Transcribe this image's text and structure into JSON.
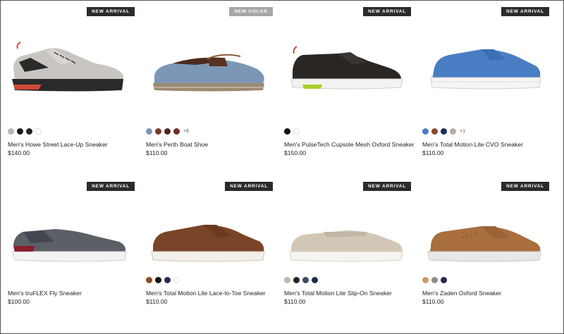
{
  "products": [
    {
      "badge": "NEW ARRIVAL",
      "badge_style": "dark",
      "name": "Men's Howe Street Lace-Up Sneaker",
      "price": "$140.00",
      "swatches": [
        "#b8b8b8",
        "#1a1a1a",
        "#222222",
        "#ffffff"
      ],
      "more": "",
      "image": "gray sneaker with red sole accent"
    },
    {
      "badge": "NEW COLOR",
      "badge_style": "light",
      "name": "Men's Perth Boat Shoe",
      "price": "$110.00",
      "swatches": [
        "#7c97b6",
        "#7b3a28",
        "#4a2a1e",
        "#6f2f28"
      ],
      "more": "+6",
      "image": "blue boat shoe with brown lacing"
    },
    {
      "badge": "NEW ARRIVAL",
      "badge_style": "dark",
      "name": "Men's PulseTech Cupsole Mesh Oxford Sneaker",
      "price": "$150.00",
      "swatches": [
        "#111111",
        "#ffffff"
      ],
      "more": "",
      "image": "black mesh sneaker with green heel"
    },
    {
      "badge": "NEW ARRIVAL",
      "badge_style": "dark",
      "name": "Men's Total Motion Lite CVO Sneaker",
      "price": "$110.00",
      "swatches": [
        "#4a7ec4",
        "#8a4a2a",
        "#1f2c55",
        "#b9aca2"
      ],
      "more": "+1",
      "image": "blue suede sneaker"
    },
    {
      "badge": "NEW ARRIVAL",
      "badge_style": "dark",
      "name": "Men's truFLEX Fly Sneaker",
      "price": "$100.00",
      "swatches": [],
      "more": "",
      "image": "gray knit sneaker with red heel"
    },
    {
      "badge": "NEW ARRIVAL",
      "badge_style": "dark",
      "name": "Men's Total Motion Lite Lace-to-Toe Sneaker",
      "price": "$110.00",
      "swatches": [
        "#8a4a2a",
        "#111111",
        "#1f2c55",
        "#ffffff"
      ],
      "more": "",
      "image": "brown leather lace-to-toe sneaker"
    },
    {
      "badge": "NEW ARRIVAL",
      "badge_style": "dark",
      "name": "Men's Total Motion Lite Slip-On Sneaker",
      "price": "$110.00",
      "swatches": [
        "#c2b7a4",
        "#222222",
        "#3f4a55",
        "#1f2c55"
      ],
      "more": "",
      "image": "taupe suede slip-on sneaker"
    },
    {
      "badge": "NEW ARRIVAL",
      "badge_style": "dark",
      "name": "Men's Zaden Oxford Sneaker",
      "price": "$110.00",
      "swatches": [
        "#c89a6a",
        "#8b8b8b",
        "#1f2c55"
      ],
      "more": "",
      "image": "tan perforated leather oxford sneaker"
    }
  ]
}
